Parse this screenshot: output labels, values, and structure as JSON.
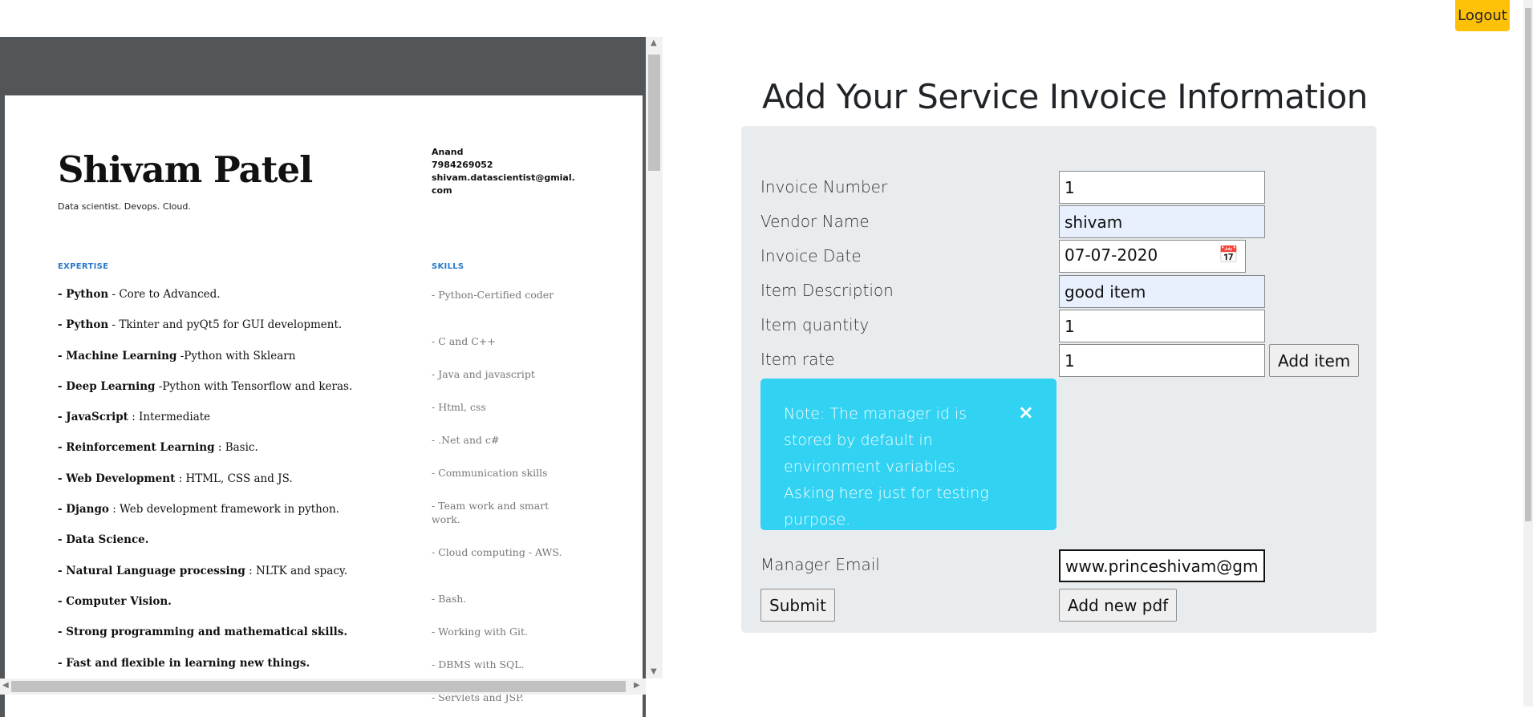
{
  "resume": {
    "name": "Shivam Patel",
    "tagline": "Data scientist. Devops. Cloud.",
    "contact": [
      "Anand",
      "7984269052",
      "shivam.datascientist@gmial.com"
    ],
    "expertise_heading": "EXPERTISE",
    "skills_heading": "SKILLS",
    "expertise": [
      {
        "bold": "- Python",
        "text": " - Core to Advanced."
      },
      {
        "bold": "- Python",
        "text": " - Tkinter and pyQt5 for GUI development."
      },
      {
        "bold": "- Machine Learning",
        "text": " -Python with Sklearn"
      },
      {
        "bold": "- Deep Learning",
        "text": " -Python with Tensorflow and keras."
      },
      {
        "bold": "- JavaScript",
        "text": " : Intermediate"
      },
      {
        "bold": "- Reinforcement Learning",
        "text": " : Basic."
      },
      {
        "bold": "- Web Development",
        "text": " : HTML, CSS and JS."
      },
      {
        "bold": "- Django",
        "text": " : Web development framework in python."
      },
      {
        "bold": "- Data Science.",
        "text": ""
      },
      {
        "bold": "- Natural Language processing",
        "text": " : NLTK and spacy."
      },
      {
        "bold": "- Computer Vision.",
        "text": ""
      },
      {
        "bold": "- Strong programming and mathematical skills.",
        "text": ""
      },
      {
        "bold": "- Fast and flexible in learning new things.",
        "text": ""
      }
    ],
    "skills": [
      "- Python-Certified coder",
      "- C and C++",
      "- Java and javascript",
      "- Html, css",
      "- .Net and c#",
      "- Communication skills",
      "- Team work and smart work.",
      "- Cloud computing - AWS.",
      "- Bash.",
      "- Working with Git.",
      "- DBMS with SQL.",
      "- Servlets and JSP."
    ]
  },
  "header": {
    "logout_label": "Logout",
    "title": "Add Your Service Invoice Information"
  },
  "form": {
    "invoice_number": {
      "label": "Invoice Number",
      "value": "1"
    },
    "vendor_name": {
      "label": "Vendor Name",
      "value": "shivam"
    },
    "invoice_date": {
      "label": "Invoice Date",
      "value": "07-07-2020"
    },
    "item_description": {
      "label": "Item Description",
      "value": "good item"
    },
    "item_quantity": {
      "label": "Item quantity",
      "value": "1"
    },
    "item_rate": {
      "label": "Item rate",
      "value": "1"
    },
    "add_item_label": "Add item",
    "note": "Note: The manager id is stored by default in environment variables. Asking here just for testing purpose.",
    "close_glyph": "×",
    "manager_email": {
      "label": "Manager Email",
      "value": "www.princeshivam@gmail.com"
    },
    "submit_label": "Submit",
    "add_pdf_label": "Add new pdf"
  },
  "colors": {
    "logout": "#ffc107",
    "alert": "#31d2f2",
    "panel": "#e9ecef",
    "section_heading": "#2a7ac9"
  }
}
